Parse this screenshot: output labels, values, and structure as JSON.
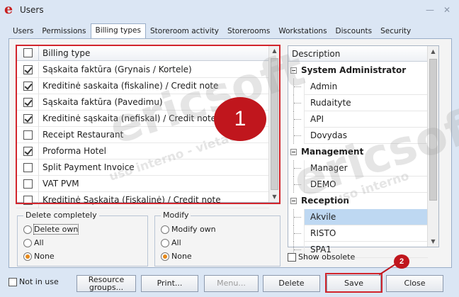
{
  "window": {
    "title": "Users",
    "logo_letter": "e"
  },
  "tabs": [
    {
      "label": "Users"
    },
    {
      "label": "Permissions"
    },
    {
      "label": "Billing types",
      "active": true
    },
    {
      "label": "Storeroom activity"
    },
    {
      "label": "Storerooms"
    },
    {
      "label": "Workstations"
    },
    {
      "label": "Discounts"
    },
    {
      "label": "Security"
    }
  ],
  "billing": {
    "header": "Billing type",
    "rows": [
      {
        "label": "Sąskaita faktūra (Grynais / Kortele)",
        "checked": true
      },
      {
        "label": "Kreditinė saskaita (fiskaline) / Credit note",
        "checked": true
      },
      {
        "label": "Sąskaita faktūra (Pavedimu)",
        "checked": true
      },
      {
        "label": "Kreditinė sąskaita (nefiskal) / Credit note",
        "checked": true
      },
      {
        "label": "Receipt Restaurant",
        "checked": false
      },
      {
        "label": "Proforma Hotel",
        "checked": true
      },
      {
        "label": "Split Payment Invoice",
        "checked": false
      },
      {
        "label": "VAT PVM",
        "checked": false
      },
      {
        "label": "Kreditinė Sąskaita (Fiskalinė) / Credit note",
        "checked": false
      }
    ]
  },
  "annotations": {
    "badge1": "1",
    "badge2": "2"
  },
  "delete_completely": {
    "title": "Delete completely",
    "options": [
      {
        "label": "Delete own",
        "selected": false
      },
      {
        "label": "All",
        "selected": false
      },
      {
        "label": "None",
        "selected": true
      }
    ]
  },
  "modify": {
    "title": "Modify",
    "options": [
      {
        "label": "Modify own",
        "selected": false
      },
      {
        "label": "All",
        "selected": false
      },
      {
        "label": "None",
        "selected": true
      }
    ]
  },
  "description": {
    "header": "Description",
    "rows": [
      {
        "type": "group",
        "label": "System Administrator"
      },
      {
        "type": "item",
        "label": "Admin"
      },
      {
        "type": "item",
        "label": "Rudaityte"
      },
      {
        "type": "item",
        "label": "API"
      },
      {
        "type": "item",
        "label": "Dovydas"
      },
      {
        "type": "group",
        "label": "Management"
      },
      {
        "type": "item",
        "label": "Manager"
      },
      {
        "type": "item",
        "label": "DEMO"
      },
      {
        "type": "group",
        "label": "Reception"
      },
      {
        "type": "item",
        "label": "Akvile",
        "selected": true
      },
      {
        "type": "item",
        "label": "RISTO"
      },
      {
        "type": "item",
        "label": "SPA1"
      }
    ]
  },
  "show_obsolete": "Show obsolete",
  "not_in_use": "Not in use",
  "buttons": {
    "resource_groups_line1": "Resource",
    "resource_groups_line2": "groups...",
    "print": "Print...",
    "menu": "Menu...",
    "delete": "Delete",
    "save": "Save",
    "close": "Close"
  },
  "watermark": [
    "ericsoft",
    "uso interno - vietata",
    "ericsoft",
    "uso interno"
  ],
  "colors": {
    "accent_red": "#c0161d",
    "selection": "#bed8f2",
    "radio_dot": "#e5891c"
  }
}
